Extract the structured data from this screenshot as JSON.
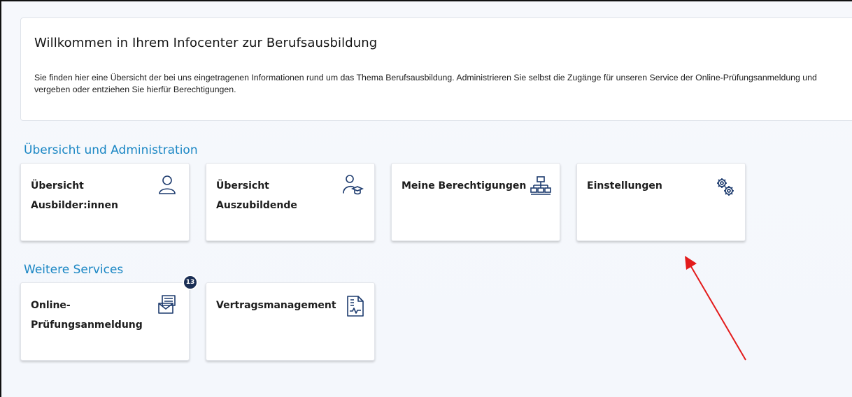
{
  "welcome": {
    "title": "Willkommen in Ihrem Infocenter zur Berufsausbildung",
    "text": "Sie finden hier eine Übersicht der bei uns eingetragenen Informationen rund um das Thema Berufsausbildung. Administrieren Sie selbst die Zugänge für unseren Service der Online-Prüfungsanmeldung und vergeben oder entziehen Sie hierfür Berechtigungen."
  },
  "sections": {
    "admin_title": "Übersicht und Administration",
    "services_title": "Weitere Services"
  },
  "cards": {
    "ausbilder": {
      "label": "Übersicht Ausbilder:innen",
      "icon": "person-icon"
    },
    "azubis": {
      "label": "Übersicht Auszubildende",
      "icon": "student-icon"
    },
    "berechtigungen": {
      "label": "Meine Berechtigungen",
      "icon": "hierarchy-icon"
    },
    "einstellungen": {
      "label": "Einstellungen",
      "icon": "gears-icon"
    },
    "pruefung": {
      "label": "Online-Prüfungsanmeldung",
      "icon": "mail-stack-icon",
      "badge": "13"
    },
    "vertrag": {
      "label": "Vertragsmanagement",
      "icon": "contract-document-icon"
    }
  },
  "colors": {
    "accent": "#1b87c4",
    "icon": "#1d3b6e",
    "badge": "#1b2f55",
    "annotation_arrow": "#e31b1b"
  }
}
